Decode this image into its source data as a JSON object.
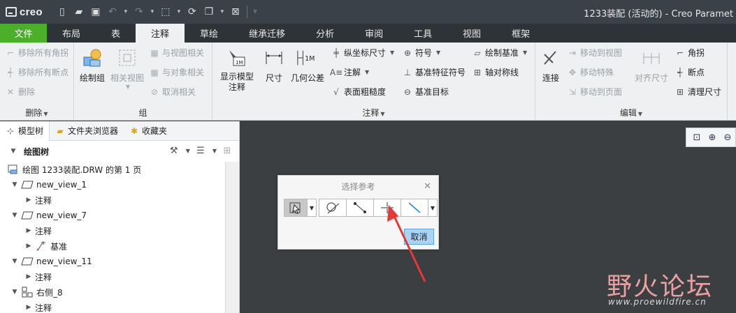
{
  "app": {
    "logo": "creo",
    "window_title": "1233装配 (活动的) - Creo Paramet"
  },
  "tabs": [
    "文件",
    "布局",
    "表",
    "注释",
    "草绘",
    "继承迁移",
    "分析",
    "审阅",
    "工具",
    "视图",
    "框架"
  ],
  "active_tab": "注释",
  "ribbon": {
    "delete_group": {
      "label": "删除",
      "items": [
        "移除所有角拐",
        "移除所有断点",
        "删除"
      ]
    },
    "group_group": {
      "label": "组",
      "big": [
        "绘制组",
        "相关视图"
      ],
      "items": [
        "与视图相关",
        "与对象相关",
        "取消相关"
      ]
    },
    "annotation_group": {
      "label": "注释",
      "show_model": "显示模型\n注释",
      "dimension": "尺寸",
      "gtol": "几何公差",
      "col1": [
        "纵坐标尺寸",
        "注解",
        "表面粗糙度"
      ],
      "col2": [
        "符号",
        "基准特征符号",
        "基准目标"
      ],
      "col3": [
        "绘制基准",
        "轴对称线"
      ]
    },
    "edit_group": {
      "label": "编辑",
      "connect": "连接",
      "col1": [
        "移动到视图",
        "移动特殊",
        "移动到页面"
      ],
      "align": "对齐尺寸",
      "col2": [
        "角拐",
        "断点",
        "清理尺寸"
      ]
    }
  },
  "panel": {
    "tabs": [
      "模型树",
      "文件夹浏览器",
      "收藏夹"
    ],
    "tree_title": "绘图树",
    "nodes": [
      {
        "label": "绘图 1233装配.DRW 的第 1 页"
      },
      {
        "label": "new_view_1"
      },
      {
        "label": "注释"
      },
      {
        "label": "new_view_7"
      },
      {
        "label": "注释"
      },
      {
        "label": "基准"
      },
      {
        "label": "new_view_11"
      },
      {
        "label": "注释"
      },
      {
        "label": "右侧_8"
      },
      {
        "label": "注释"
      }
    ]
  },
  "dialog": {
    "title": "选择参考",
    "cancel": "取消"
  },
  "watermark": {
    "cn": "野火论坛",
    "en": "www.proewildfire.cn"
  },
  "colors": {
    "file_tab": "#4caf2a",
    "ribbon_bg": "#eef0f2",
    "canvas_bg": "#3c3f41",
    "arrow": "#e53935"
  }
}
